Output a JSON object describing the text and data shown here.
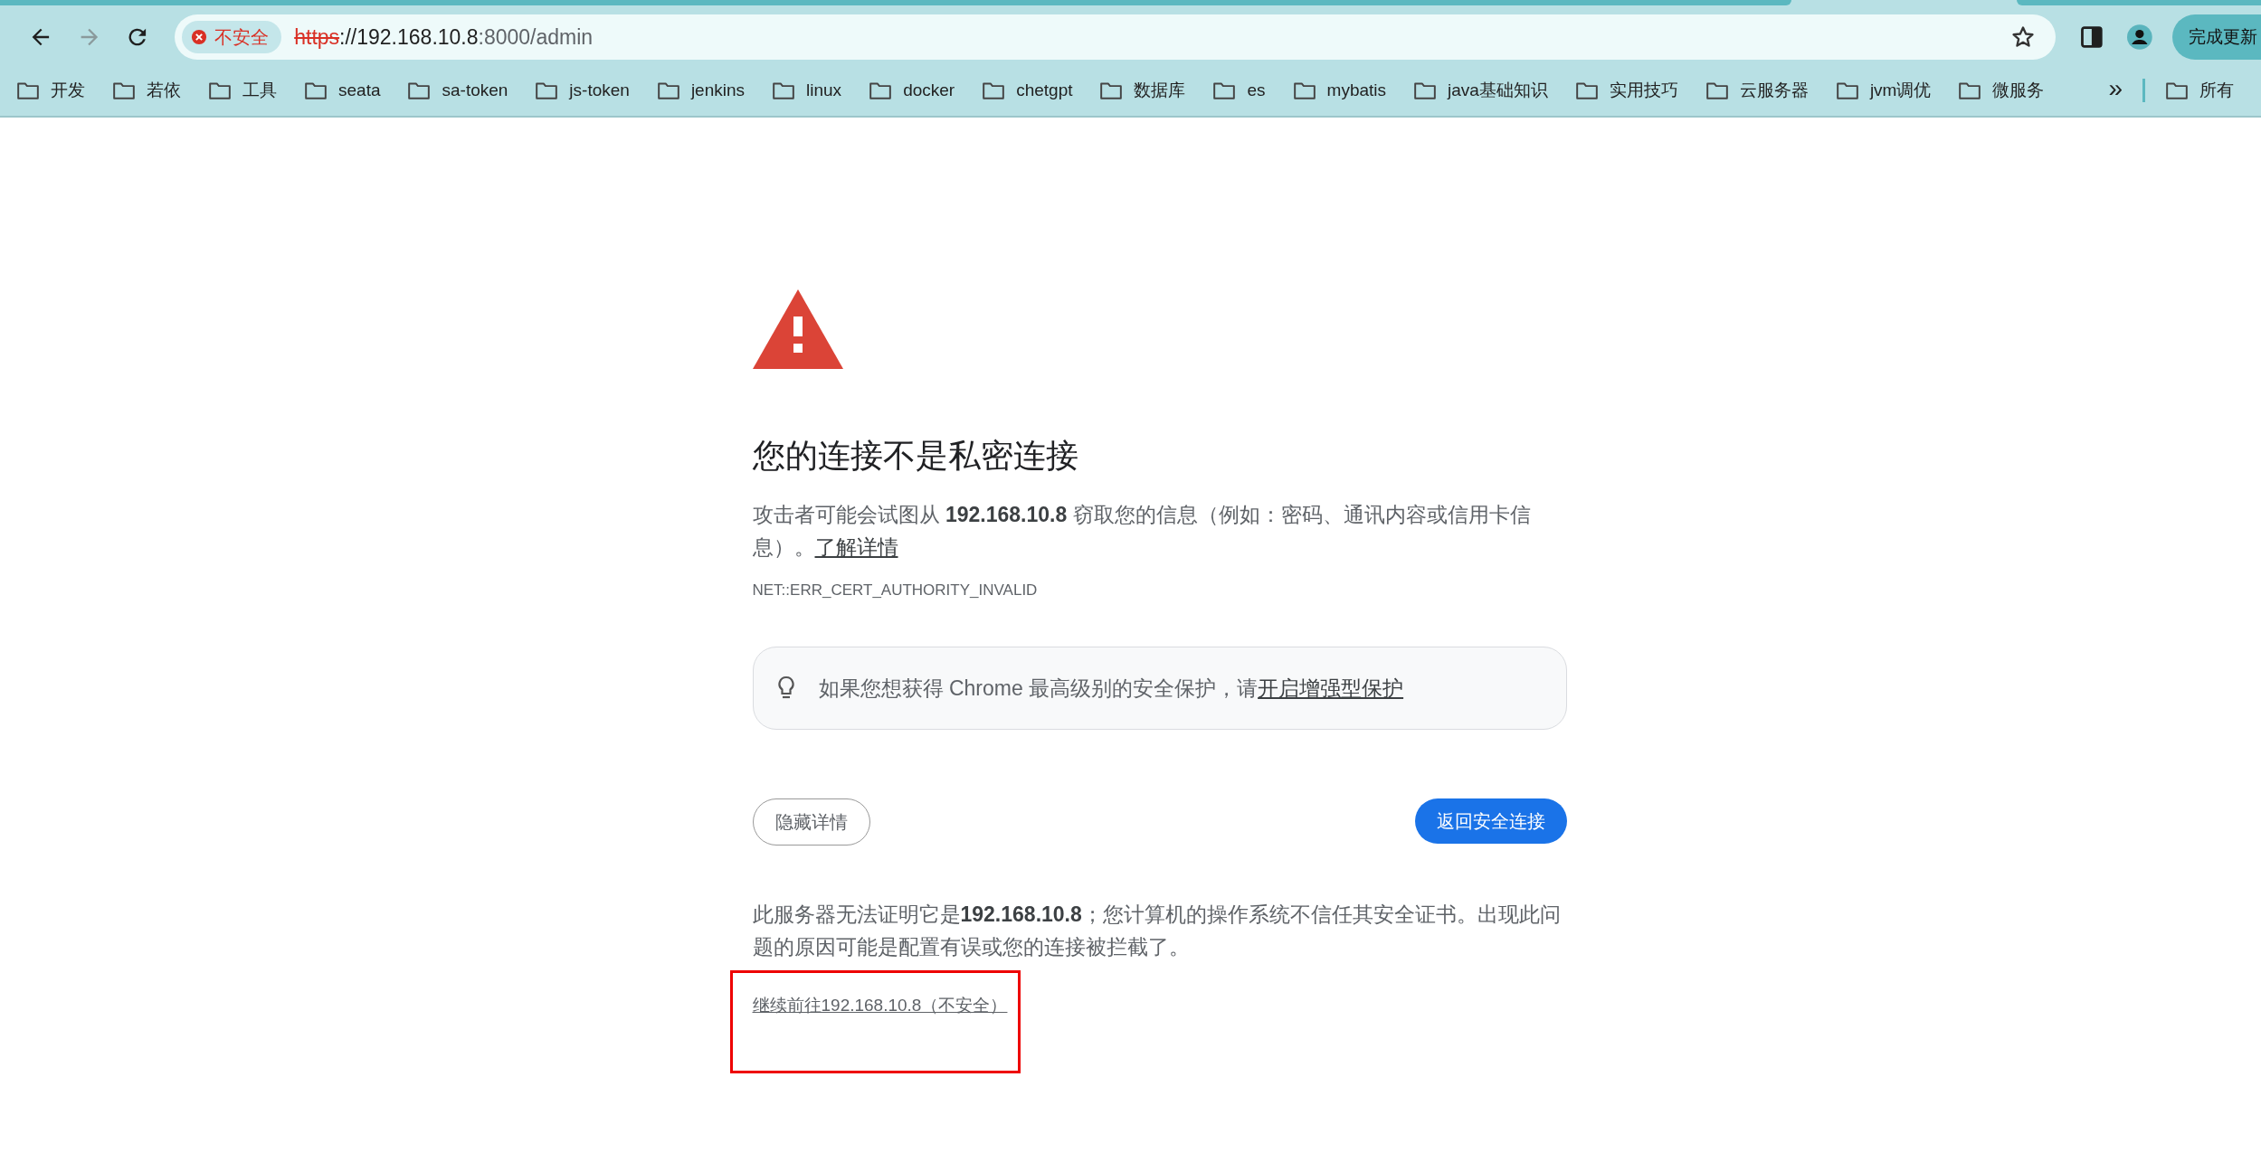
{
  "browser": {
    "security_chip": "不安全",
    "url": {
      "scheme": "https",
      "host": "://192.168.10.8",
      "path": ":8000/admin"
    },
    "update_button": "完成更新"
  },
  "bookmarks": [
    "开发",
    "若依",
    "工具",
    "seata",
    "sa-token",
    "js-token",
    "jenkins",
    "linux",
    "docker",
    "chetgpt",
    "数据库",
    "es",
    "mybatis",
    "java基础知识",
    "实用技巧",
    "云服务器",
    "jvm调优",
    "微服务"
  ],
  "bookmarks_overflow": "»",
  "bookmarks_pinned": "所有",
  "page": {
    "heading": "您的连接不是私密连接",
    "message": "攻击者可能会试图从 **192.168.10.8** 窃取您的信息（例如：密码、通讯内容或信用卡信息）。",
    "learn_more": "了解详情",
    "error_code": "NET::ERR_CERT_AUTHORITY_INVALID",
    "tip": "如果您想获得 Chrome 最高级别的安全保护，请",
    "tip_link": "开启增强型保护",
    "details_button": "隐藏详情",
    "back_button": "返回安全连接",
    "details": "此服务器无法证明它是**192.168.10.8**；您计算机的操作系统不信任其安全证书。出现此问题的原因可能是配置有误或您的连接被拦截了。",
    "proceed_link": "继续前往192.168.10.8（不安全）",
    "highlighted": true
  }
}
